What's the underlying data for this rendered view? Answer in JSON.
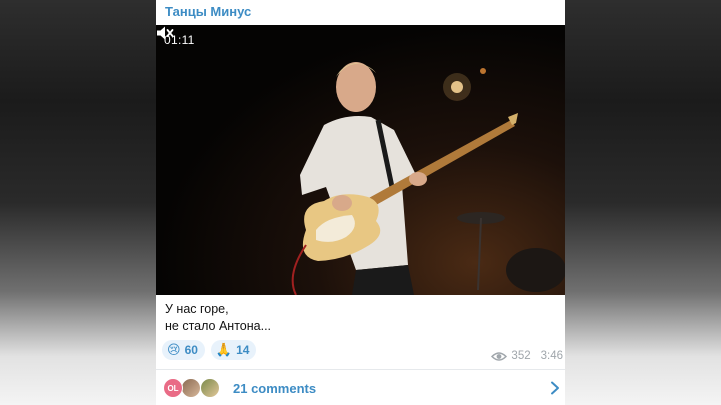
{
  "post": {
    "channel_name": "Танцы Минус",
    "video": {
      "timecode": "01:11",
      "mute_icon": "speaker-muted-icon"
    },
    "caption_lines": [
      "У нас горе,",
      "не стало Антона..."
    ],
    "reactions": [
      {
        "emoji": "😢",
        "count": "60"
      },
      {
        "emoji": "🙏",
        "count": "14"
      }
    ],
    "views": "352",
    "time": "3:46",
    "comments": {
      "label": "21 comments",
      "avatars": [
        {
          "initials": "OL",
          "color": "#e96b86"
        },
        {
          "initials": ""
        },
        {
          "initials": ""
        }
      ]
    }
  },
  "colors": {
    "accent": "#3d8cc4",
    "reaction_bg": "#e8f2fb",
    "meta": "#a0a6ab"
  }
}
